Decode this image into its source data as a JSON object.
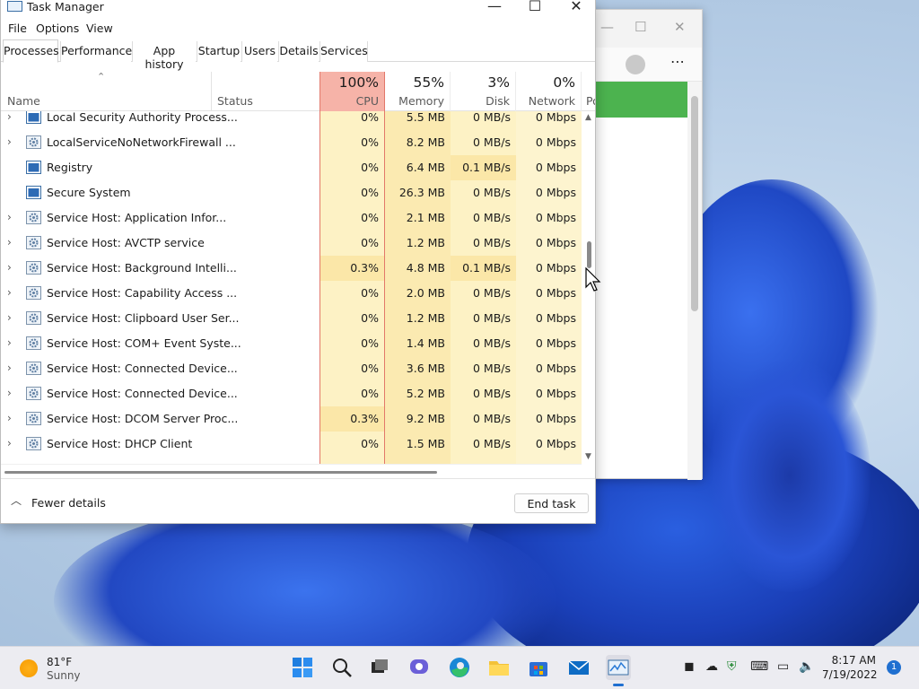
{
  "window": {
    "title": "Task Manager",
    "controls": {
      "minimize": "—",
      "maximize": "☐",
      "close": "✕"
    }
  },
  "menu": [
    "File",
    "Options",
    "View"
  ],
  "tabs": [
    {
      "label": "Processes",
      "active": true
    },
    {
      "label": "Performance"
    },
    {
      "label": "App history"
    },
    {
      "label": "Startup"
    },
    {
      "label": "Users"
    },
    {
      "label": "Details"
    },
    {
      "label": "Services"
    }
  ],
  "columns": {
    "name": "Name",
    "status": "Status",
    "cpu": {
      "pct": "100%",
      "label": "CPU"
    },
    "memory": {
      "pct": "55%",
      "label": "Memory"
    },
    "disk": {
      "pct": "3%",
      "label": "Disk"
    },
    "network": {
      "pct": "0%",
      "label": "Network"
    },
    "power_partial": "Po"
  },
  "processes": [
    {
      "name": "Local Security Authority Process...",
      "expandable": true,
      "icon": "app-window-icon",
      "cpu": "0%",
      "memory": "5.5 MB",
      "disk": "0 MB/s",
      "network": "0 Mbps"
    },
    {
      "name": "LocalServiceNoNetworkFirewall ...",
      "expandable": true,
      "icon": "gear-icon",
      "cpu": "0%",
      "memory": "8.2 MB",
      "disk": "0 MB/s",
      "network": "0 Mbps"
    },
    {
      "name": "Registry",
      "expandable": false,
      "icon": "app-window-icon",
      "cpu": "0%",
      "memory": "6.4 MB",
      "disk": "0.1 MB/s",
      "network": "0 Mbps"
    },
    {
      "name": "Secure System",
      "expandable": false,
      "icon": "app-window-icon",
      "cpu": "0%",
      "memory": "26.3 MB",
      "disk": "0 MB/s",
      "network": "0 Mbps"
    },
    {
      "name": "Service Host: Application Infor...",
      "expandable": true,
      "icon": "gear-icon",
      "cpu": "0%",
      "memory": "2.1 MB",
      "disk": "0 MB/s",
      "network": "0 Mbps"
    },
    {
      "name": "Service Host: AVCTP service",
      "expandable": true,
      "icon": "gear-icon",
      "cpu": "0%",
      "memory": "1.2 MB",
      "disk": "0 MB/s",
      "network": "0 Mbps"
    },
    {
      "name": "Service Host: Background Intelli...",
      "expandable": true,
      "icon": "gear-icon",
      "cpu": "0.3%",
      "memory": "4.8 MB",
      "disk": "0.1 MB/s",
      "network": "0 Mbps"
    },
    {
      "name": "Service Host: Capability Access ...",
      "expandable": true,
      "icon": "gear-icon",
      "cpu": "0%",
      "memory": "2.0 MB",
      "disk": "0 MB/s",
      "network": "0 Mbps"
    },
    {
      "name": "Service Host: Clipboard User Ser...",
      "expandable": true,
      "icon": "gear-icon",
      "cpu": "0%",
      "memory": "1.2 MB",
      "disk": "0 MB/s",
      "network": "0 Mbps"
    },
    {
      "name": "Service Host: COM+ Event Syste...",
      "expandable": true,
      "icon": "gear-icon",
      "cpu": "0%",
      "memory": "1.4 MB",
      "disk": "0 MB/s",
      "network": "0 Mbps"
    },
    {
      "name": "Service Host: Connected Device...",
      "expandable": true,
      "icon": "gear-icon",
      "cpu": "0%",
      "memory": "3.6 MB",
      "disk": "0 MB/s",
      "network": "0 Mbps"
    },
    {
      "name": "Service Host: Connected Device...",
      "expandable": true,
      "icon": "gear-icon",
      "cpu": "0%",
      "memory": "5.2 MB",
      "disk": "0 MB/s",
      "network": "0 Mbps"
    },
    {
      "name": "Service Host: DCOM Server Proc...",
      "expandable": true,
      "icon": "gear-icon",
      "cpu": "0.3%",
      "memory": "9.2 MB",
      "disk": "0 MB/s",
      "network": "0 Mbps"
    },
    {
      "name": "Service Host: DHCP Client",
      "expandable": true,
      "icon": "gear-icon",
      "cpu": "0%",
      "memory": "1.5 MB",
      "disk": "0 MB/s",
      "network": "0 Mbps"
    }
  ],
  "footer": {
    "fewer_details": "Fewer details",
    "end_task": "End task"
  },
  "colors": {
    "cpu_header": "#f6b3a8",
    "cpu_cell": "#fdf2c5",
    "cpu_cell_hot": "#fbe7a8",
    "mem_cell": "#fbeab1",
    "disk_cell": "#fdf2c5",
    "net_cell": "#fdf4cf",
    "cpu_border": "#e2786a"
  },
  "taskbar": {
    "weather_temp": "81°F",
    "weather_desc": "Sunny",
    "time": "8:17 AM",
    "date": "7/19/2022",
    "notification_count": "1",
    "apps": [
      "start-icon",
      "search-icon",
      "task-view-icon",
      "chat-icon",
      "edge-icon",
      "file-explorer-icon",
      "store-icon",
      "mail-icon",
      "task-manager-icon"
    ]
  }
}
